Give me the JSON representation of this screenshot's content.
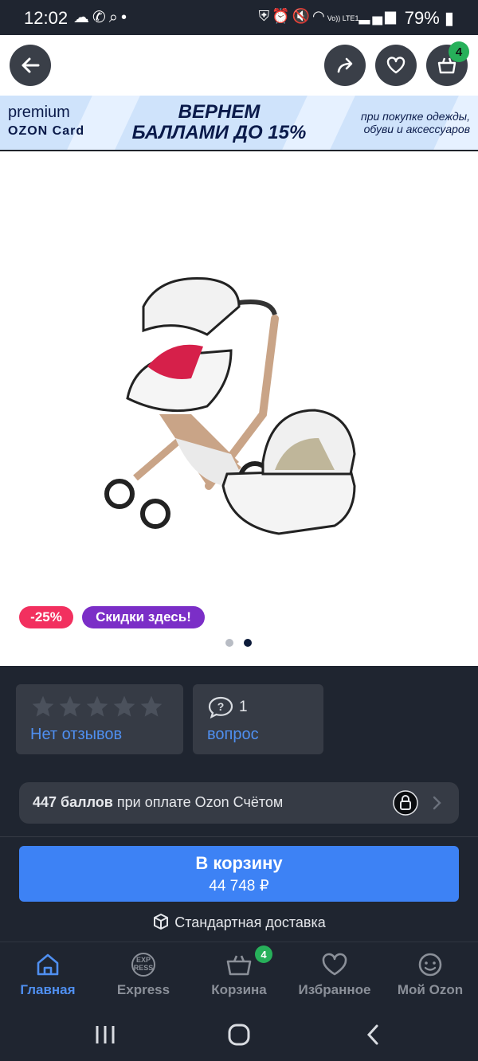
{
  "status_bar": {
    "time": "12:02",
    "left_icons": [
      "cloud-upload-icon",
      "whatsapp-icon",
      "search-icon",
      "dot-icon"
    ],
    "right_icons": [
      "vpn-icon",
      "alarm-icon",
      "mute-icon",
      "wifi-icon",
      "volte-icon",
      "signal-icon"
    ],
    "volte_text": "Vo)) LTE1",
    "battery": "79%"
  },
  "top_nav": {
    "back_icon": "arrow-left-icon",
    "share_icon": "share-icon",
    "favorite_icon": "heart-icon",
    "cart_icon": "cart-icon",
    "cart_count": "4"
  },
  "banner": {
    "brand_line1": "premium",
    "brand_line2": "OZON Card",
    "headline": "ВЕРНЕМ БАЛЛАМИ ДО 15%",
    "subtext": "при покупке одежды, обуви и аксессуаров",
    "background": "#cfe3fb"
  },
  "gallery": {
    "image": "stroller-photo",
    "discount_badge": "-25%",
    "promo_badge": "Скидки здесь!",
    "discount_color": "#f2305f",
    "promo_color": "#7b2ec7",
    "dots_total": 2,
    "active_dot": 2
  },
  "reviews": {
    "star_count": 5,
    "rating": 0,
    "label": "Нет отзывов"
  },
  "questions": {
    "icon": "question-bubble-icon",
    "count": "1",
    "label": "вопрос"
  },
  "points": {
    "bold": "447 баллов",
    "text": "при оплате Ozon Счётом",
    "lock_icon": "lock-icon",
    "chevron_icon": "chevron-right-icon"
  },
  "cart_button": {
    "label": "В корзину",
    "price": "44 748 ₽",
    "color": "#3d82f5"
  },
  "delivery": {
    "icon": "box-icon",
    "label": "Стандартная доставка"
  },
  "bottom_nav": {
    "tabs": [
      {
        "label": "Главная",
        "icon": "home-icon",
        "active": true
      },
      {
        "label": "Express",
        "icon": "express-icon",
        "active": false
      },
      {
        "label": "Корзина",
        "icon": "basket-icon",
        "active": false,
        "badge": "4"
      },
      {
        "label": "Избранное",
        "icon": "heart-icon",
        "active": false
      },
      {
        "label": "Мой Ozon",
        "icon": "smile-icon",
        "active": false
      }
    ],
    "express_icon_text": "EXP RESS",
    "active_color": "#4f8ff0"
  },
  "system_nav": {
    "buttons": [
      "recent-apps-icon",
      "home-circle-icon",
      "back-chevron-icon"
    ]
  }
}
